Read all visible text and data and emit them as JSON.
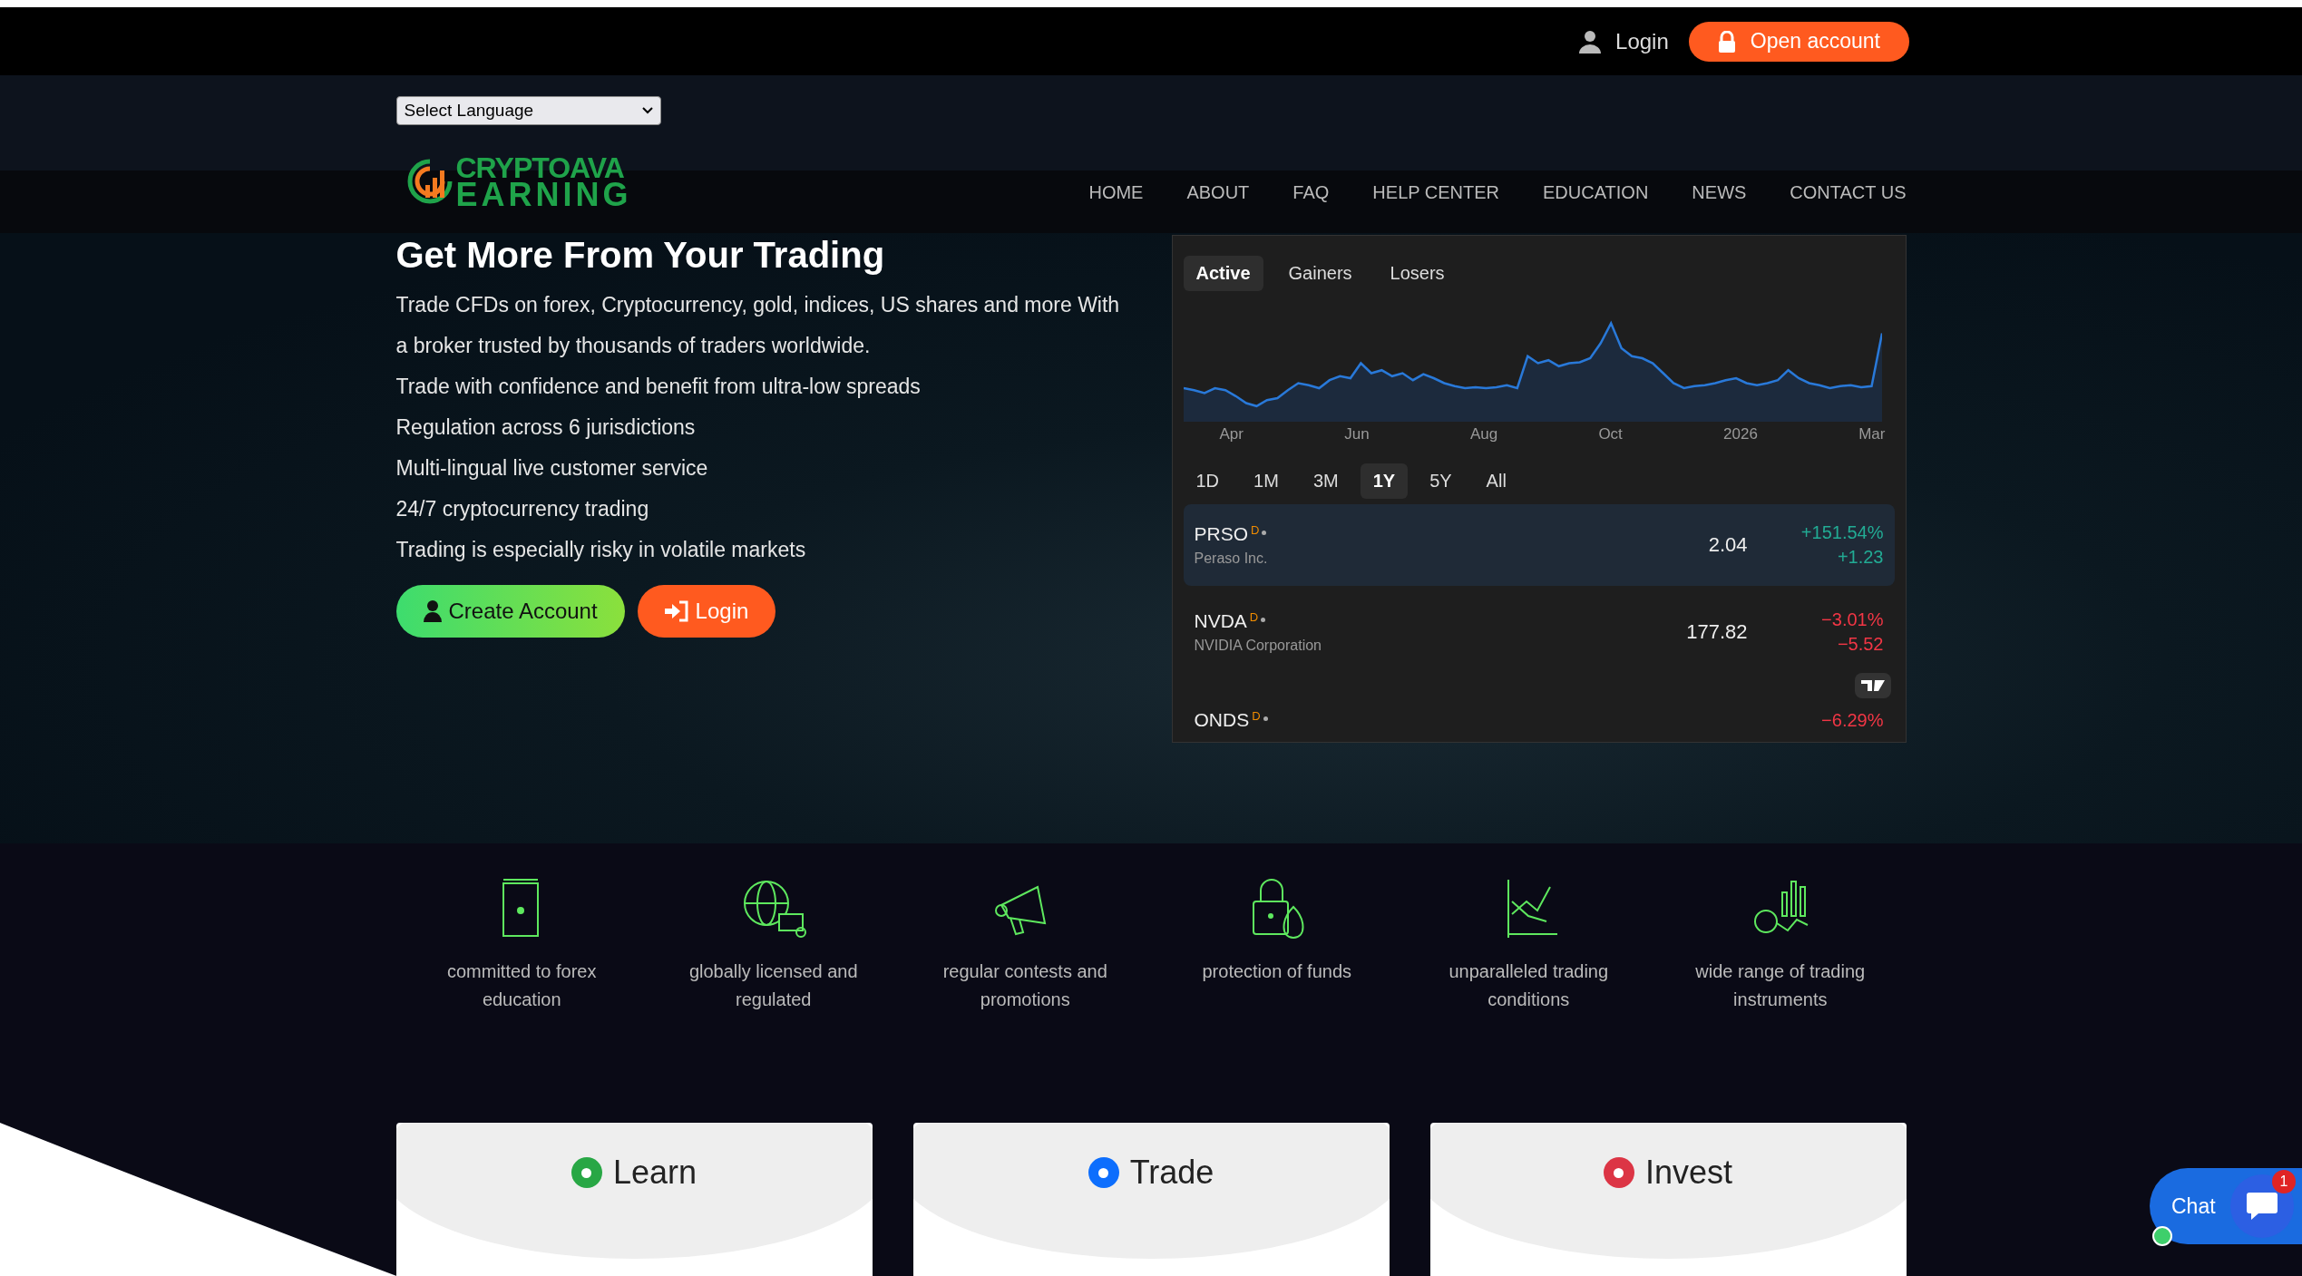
{
  "top_bar": {
    "login": "Login",
    "open_account": "Open account"
  },
  "language_select": {
    "value": "Select Language"
  },
  "logo": {
    "line1": "CRYPTOAVA",
    "line2": "EARNING"
  },
  "nav": [
    {
      "label": "HOME"
    },
    {
      "label": "ABOUT"
    },
    {
      "label": "FAQ"
    },
    {
      "label": "HELP CENTER"
    },
    {
      "label": "EDUCATION"
    },
    {
      "label": "NEWS"
    },
    {
      "label": "CONTACT US"
    }
  ],
  "hero": {
    "title": "Get More From Your Trading",
    "lines": [
      "Trade CFDs on forex, Cryptocurrency, gold, indices, US shares and more With a broker trusted by thousands of traders worldwide.",
      "Trade with confidence and benefit from ultra-low spreads",
      "Regulation across 6 jurisdictions",
      "Multi-lingual live customer service",
      "24/7 cryptocurrency trading",
      "Trading is especially risky in volatile markets"
    ],
    "buttons": [
      {
        "label": "Create Account",
        "kind": "primary"
      },
      {
        "label": "Login",
        "kind": "secondary"
      }
    ]
  },
  "market_widget": {
    "tabs": [
      {
        "label": "Active",
        "selected": true
      },
      {
        "label": "Gainers",
        "selected": false
      },
      {
        "label": "Losers",
        "selected": false
      }
    ],
    "axis_labels": [
      "Apr",
      "Jun",
      "Aug",
      "Oct",
      "2026",
      "Mar"
    ],
    "ranges": [
      {
        "label": "1D",
        "selected": false
      },
      {
        "label": "1M",
        "selected": false
      },
      {
        "label": "3M",
        "selected": false
      },
      {
        "label": "1Y",
        "selected": true
      },
      {
        "label": "5Y",
        "selected": false
      },
      {
        "label": "All",
        "selected": false
      }
    ],
    "rows": [
      {
        "symbol": "PRSO",
        "flag": "D",
        "name": "Peraso Inc.",
        "price": "2.04",
        "change_percent": "+151.54%",
        "change": "+1.23",
        "positive": true,
        "selected": true
      },
      {
        "symbol": "NVDA",
        "flag": "D",
        "name": "NVIDIA Corporation",
        "price": "177.82",
        "change_percent": "−3.01%",
        "change": "−5.52",
        "positive": false,
        "selected": false
      },
      {
        "symbol": "ONDS",
        "flag": "D",
        "change_percent": "−6.29%",
        "positive": false,
        "selected": false
      }
    ]
  },
  "features": [
    {
      "kind": "book",
      "label": "committed to forex education"
    },
    {
      "kind": "globe",
      "label": "globally licensed and regulated"
    },
    {
      "kind": "megaphone",
      "label": "regular contests and promotions"
    },
    {
      "kind": "lock",
      "label": "protection of funds"
    },
    {
      "kind": "chart",
      "label": "unparalleled trading conditions"
    },
    {
      "kind": "instruments",
      "label": "wide range of trading instruments"
    }
  ],
  "cards": [
    {
      "title": "Learn",
      "color": "#28a745"
    },
    {
      "title": "Trade",
      "color": "#0d6efd"
    },
    {
      "title": "Invest",
      "color": "#dc3545"
    }
  ],
  "chat": {
    "label": "Chat",
    "badge": "1"
  }
}
